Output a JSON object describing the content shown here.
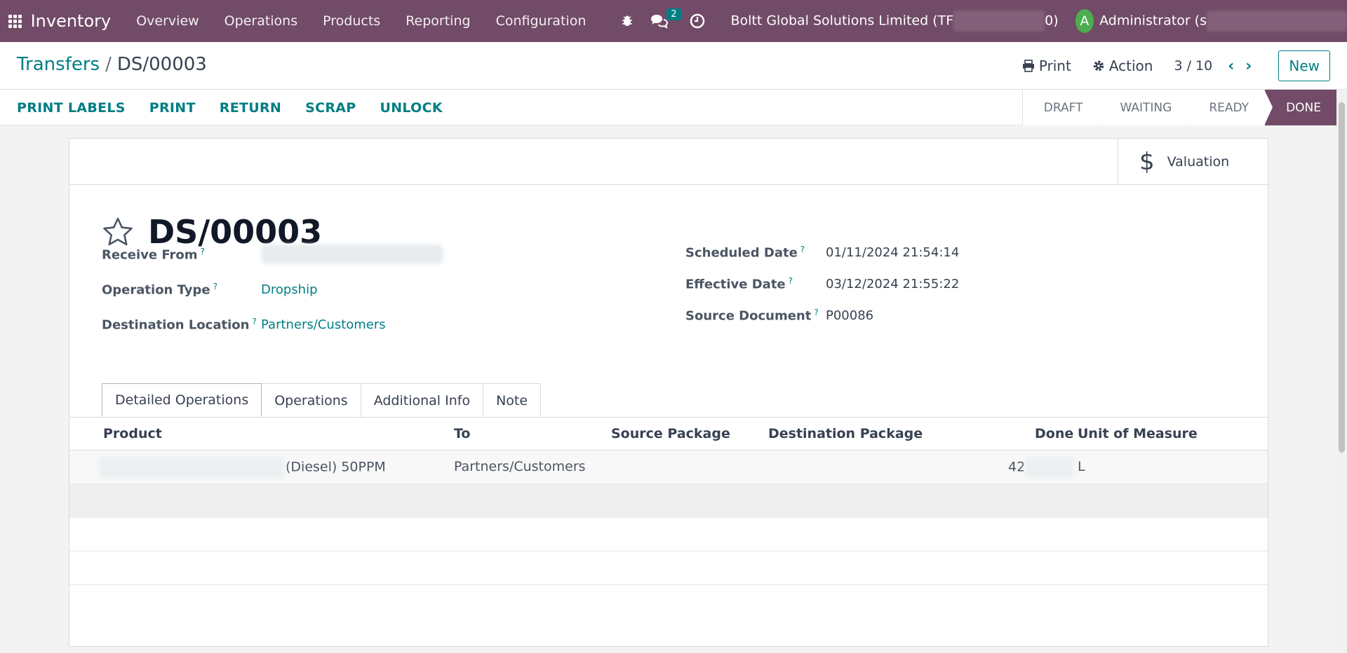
{
  "navbar": {
    "app_name": "Inventory",
    "menu": [
      "Overview",
      "Operations",
      "Products",
      "Reporting",
      "Configuration"
    ],
    "message_count": "2",
    "company_start": "Boltt Global Solutions Limited (TF",
    "company_end": "0)",
    "avatar_letter": "A",
    "user_start": "Administrator (s"
  },
  "control": {
    "breadcrumb_parent": "Transfers",
    "breadcrumb_sep": "/",
    "breadcrumb_current": "DS/00003",
    "print_label": "Print",
    "action_label": "Action",
    "pager": "3 / 10",
    "new_label": "New"
  },
  "statusbar": {
    "actions": [
      "PRINT LABELS",
      "PRINT",
      "RETURN",
      "SCRAP",
      "UNLOCK"
    ],
    "stages": [
      "DRAFT",
      "WAITING",
      "READY",
      "DONE"
    ],
    "active_stage": "DONE"
  },
  "sheet": {
    "valuation_label": "Valuation",
    "title": "DS/00003",
    "left_fields": {
      "receive_from_label": "Receive From",
      "operation_type_label": "Operation Type",
      "operation_type_value": "Dropship",
      "destination_label": "Destination Location",
      "destination_value": "Partners/Customers"
    },
    "right_fields": {
      "scheduled_label": "Scheduled Date",
      "scheduled_value": "01/11/2024 21:54:14",
      "effective_label": "Effective Date",
      "effective_value": "03/12/2024 21:55:22",
      "source_label": "Source Document",
      "source_value": "P00086"
    },
    "help_mark": "?",
    "tabs": [
      "Detailed Operations",
      "Operations",
      "Additional Info",
      "Note"
    ],
    "table": {
      "headers": [
        "Product",
        "To",
        "Source Package",
        "Destination Package",
        "Done",
        "Unit of Measure"
      ],
      "rows": [
        {
          "product_suffix": "(Diesel) 50PPM",
          "to": "Partners/Customers",
          "done_prefix": "42",
          "uom": "L"
        }
      ]
    }
  },
  "colors": {
    "brand": "#714b67",
    "accent": "#017e84"
  }
}
